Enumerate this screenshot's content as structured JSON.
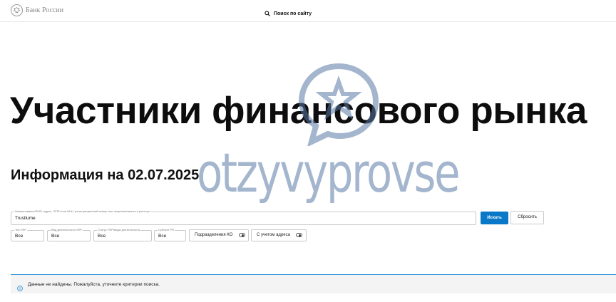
{
  "header": {
    "logo_text": "Банк России",
    "search_label": "Поиск по сайту"
  },
  "page": {
    "title": "Участники финансового рынка",
    "info_date": "Информация на 02.07.2025"
  },
  "search": {
    "label": "Наименование/ФИО, адрес, ОГРН или ИНН, регистрационный номер или лицензии/запись в реестре",
    "value": "Trustlume",
    "submit_label": "Искать",
    "reset_label": "Сбросить"
  },
  "filters": {
    "type": {
      "label": "Тип УФР",
      "value": "Все"
    },
    "activity": {
      "label": "Вид деятельности УФР",
      "value": "Все"
    },
    "status": {
      "label": "Статус УФР/виды деятельности",
      "value": "Все"
    },
    "subject": {
      "label": "Субъект РФ",
      "value": "Все"
    }
  },
  "toggles": {
    "branches": {
      "label": "Подразделения КО",
      "state": "off"
    },
    "address": {
      "label": "С учетом адреса",
      "state": "off"
    }
  },
  "notice": {
    "message": "Данные не найдены. Пожалуйста, уточните критерии поиска.",
    "icon": "info-icon"
  },
  "watermark": {
    "text": "otzyvyprovse"
  },
  "colors": {
    "accent": "#0a78c8",
    "notice_border": "#2b8fd6",
    "notice_bg": "#f4f4f4",
    "watermark": "#5a78a5"
  }
}
